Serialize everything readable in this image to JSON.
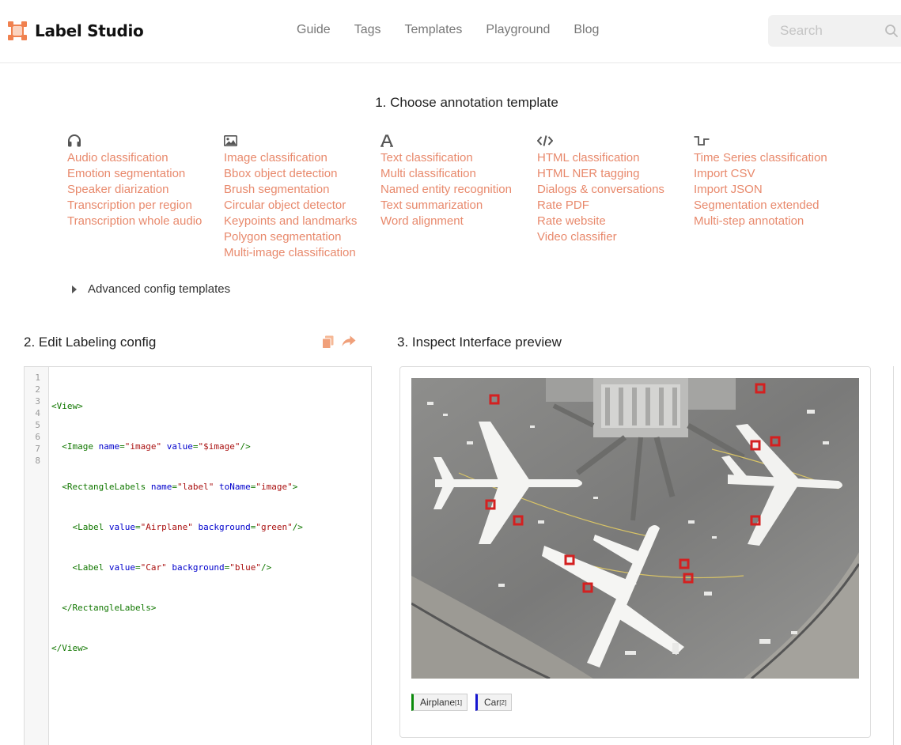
{
  "header": {
    "logo_text": "Label Studio",
    "nav": [
      "Guide",
      "Tags",
      "Templates",
      "Playground",
      "Blog"
    ],
    "search_placeholder": "Search"
  },
  "section1": {
    "title": "1. Choose annotation template",
    "columns": [
      {
        "icon": "headphones-icon",
        "items": [
          "Audio classification",
          "Emotion segmentation",
          "Speaker diarization",
          "Transcription per region",
          "Transcription whole audio"
        ]
      },
      {
        "icon": "image-icon",
        "items": [
          "Image classification",
          "Bbox object detection",
          "Brush segmentation",
          "Circular object detector",
          "Keypoints and landmarks",
          "Polygon segmentation",
          "Multi-image classification"
        ]
      },
      {
        "icon": "text-icon",
        "items": [
          "Text classification",
          "Multi classification",
          "Named entity recognition",
          "Text summarization",
          "Word alignment"
        ]
      },
      {
        "icon": "code-icon",
        "items": [
          "HTML classification",
          "HTML NER tagging",
          "Dialogs & conversations",
          "Rate PDF",
          "Rate website",
          "Video classifier"
        ]
      },
      {
        "icon": "signal-icon",
        "items": [
          "Time Series classification",
          "Import CSV",
          "Import JSON",
          "Segmentation extended",
          "Multi-step annotation"
        ]
      }
    ],
    "advanced_label": "Advanced config templates"
  },
  "section2": {
    "title": "2. Edit Labeling config",
    "line_numbers": [
      "1",
      "2",
      "3",
      "4",
      "5",
      "6",
      "7",
      "8"
    ],
    "code_lines": [
      "<View>",
      "  <Image name=\"image\" value=\"$image\"/>",
      "  <RectangleLabels name=\"label\" toName=\"image\">",
      "    <Label value=\"Airplane\" background=\"green\"/>",
      "    <Label value=\"Car\" background=\"blue\"/>",
      "  </RectangleLabels>",
      "</View>",
      ""
    ]
  },
  "section3": {
    "title": "3. Inspect Interface preview",
    "labels": [
      {
        "text": "Airplane",
        "hotkey": "[1]",
        "color": "#0a8a0a"
      },
      {
        "text": "Car",
        "hotkey": "[2]",
        "color": "#1515d0"
      }
    ]
  },
  "colors": {
    "accent": "#f0814f",
    "link": "#e8896c"
  }
}
